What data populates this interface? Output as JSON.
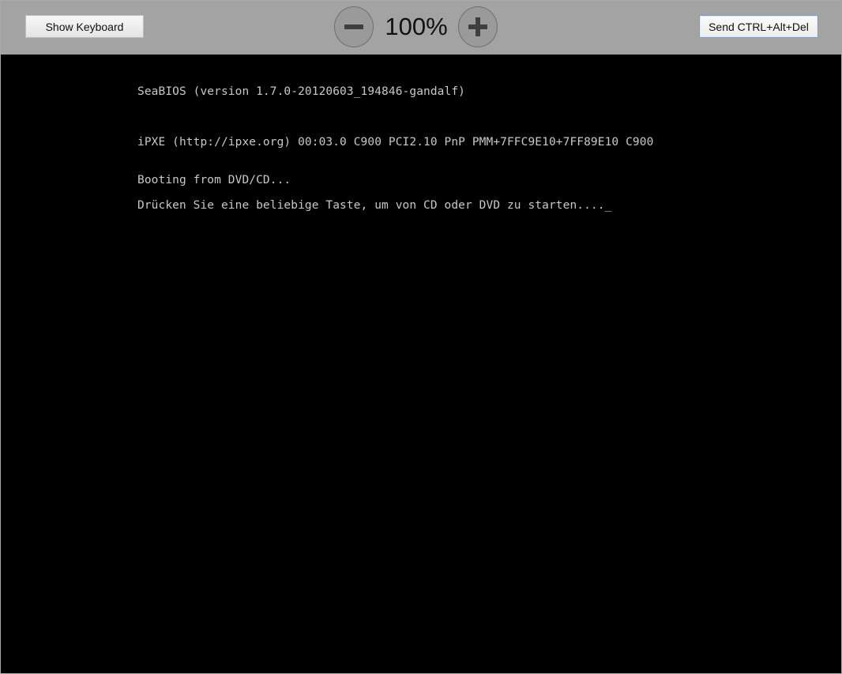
{
  "toolbar": {
    "show_keyboard_label": "Show Keyboard",
    "zoom_out_icon": "minus-icon",
    "zoom_level": "100%",
    "zoom_in_icon": "plus-icon",
    "send_cad_label": "Send CTRL+Alt+Del"
  },
  "console": {
    "lines": [
      "SeaBIOS (version 1.7.0-20120603_194846-gandalf)",
      "iPXE (http://ipxe.org) 00:03.0 C900 PCI2.10 PnP PMM+7FFC9E10+7FF89E10 C900",
      "Booting from DVD/CD...",
      "Drücken Sie eine beliebige Taste, um von CD oder DVD zu starten...."
    ],
    "cursor": "_"
  },
  "colors": {
    "toolbar_bg": "#a3a3a3",
    "screen_bg": "#000000",
    "console_text": "#c8c8c8",
    "focus_border": "#7d9bd0"
  }
}
